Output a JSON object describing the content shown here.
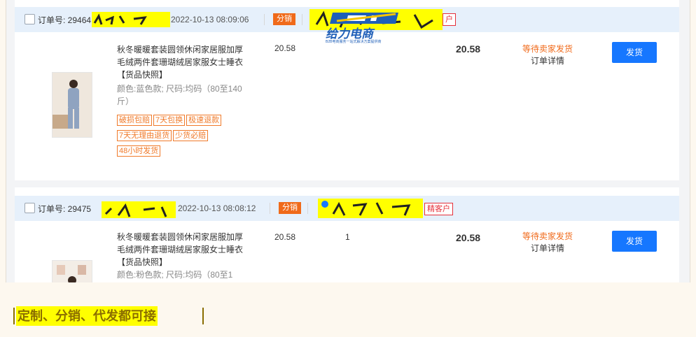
{
  "orders": [
    {
      "order_no_label": "订单号: 29464",
      "time": "2022-10-13 08:09:06",
      "tag": "分销",
      "customer_tag": "户",
      "product": {
        "title": "秋冬暖暖套装圆领休闲家居服加厚毛绒两件套珊瑚绒居家服女士睡衣【货品快照】",
        "spec": "颜色:蓝色款; 尺码:均码（80至140斤）",
        "services": [
          "破损包赔",
          "7天包换",
          "极速退款",
          "7天无理由退货",
          "少货必赔",
          "48小时发货"
        ],
        "unit_price": "20.58",
        "quantity": "",
        "total": "20.58"
      },
      "status": "等待卖家发货",
      "detail_link": "订单详情",
      "ship_button": "发货",
      "logo": {
        "name": "给力电商",
        "tagline": "B2B电商服务一站式解决方案提供商"
      }
    },
    {
      "order_no_label": "订单号: 29475",
      "time": "2022-10-13 08:08:12",
      "tag": "分销",
      "customer_tag": "精客户",
      "product": {
        "title": "秋冬暖暖套装圆领休闲家居服加厚毛绒两件套珊瑚绒居家服女士睡衣【货品快照】",
        "spec": "颜色:粉色款; 尺码:均码（80至1",
        "services": [],
        "unit_price": "20.58",
        "quantity": "1",
        "total": "20.58"
      },
      "status": "等待卖家发货",
      "detail_link": "订单详情",
      "ship_button": "发货"
    }
  ],
  "caption": "定制、分销、代发都可接",
  "colors": {
    "accent_blue": "#1677ff",
    "status_orange": "#f06a1a",
    "header_bg": "#e6f0fb",
    "highlight": "#ffff00"
  }
}
